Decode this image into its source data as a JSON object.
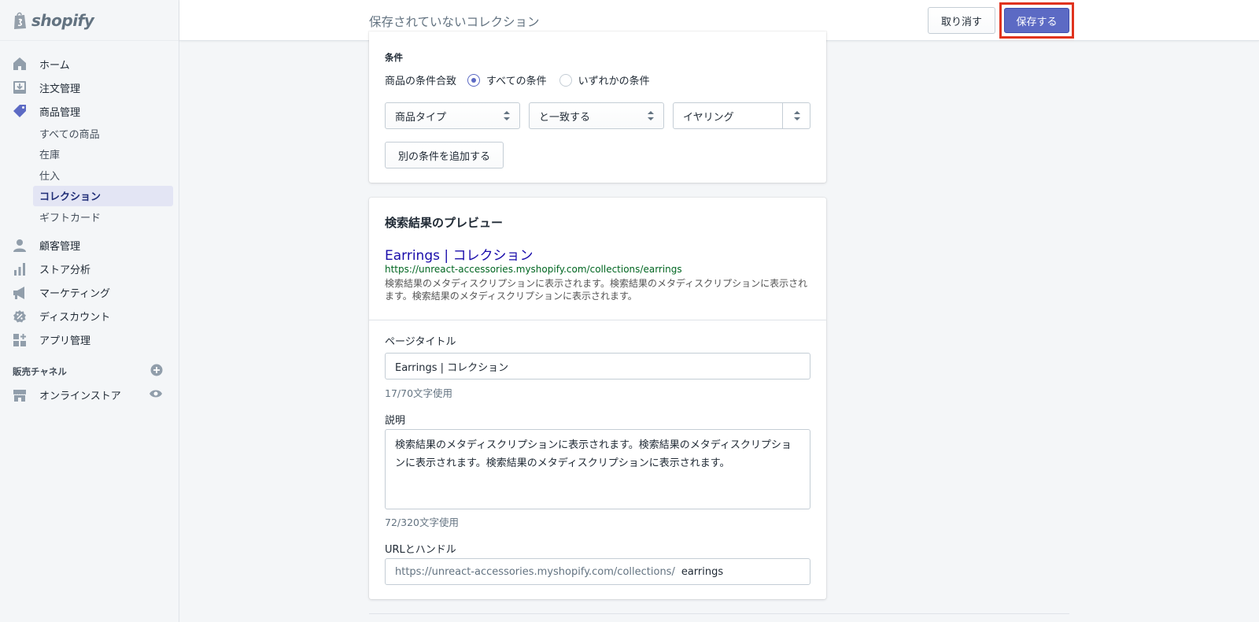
{
  "brand": {
    "name": "shopify"
  },
  "sidebar": {
    "items": [
      {
        "label": "ホーム",
        "icon": "home-icon"
      },
      {
        "label": "注文管理",
        "icon": "orders-icon"
      },
      {
        "label": "商品管理",
        "icon": "products-tag-icon"
      }
    ],
    "sub_items": [
      {
        "label": "すべての商品"
      },
      {
        "label": "在庫"
      },
      {
        "label": "仕入"
      },
      {
        "label": "コレクション",
        "active": true
      },
      {
        "label": "ギフトカード"
      }
    ],
    "items2": [
      {
        "label": "顧客管理",
        "icon": "customers-icon"
      },
      {
        "label": "ストア分析",
        "icon": "analytics-icon"
      },
      {
        "label": "マーケティング",
        "icon": "marketing-icon"
      },
      {
        "label": "ディスカウント",
        "icon": "discount-icon"
      },
      {
        "label": "アプリ管理",
        "icon": "apps-icon"
      }
    ],
    "channels_label": "販売チャネル",
    "channel": {
      "label": "オンラインストア",
      "icon": "online-store-icon"
    }
  },
  "topbar": {
    "title": "保存されていないコレクション",
    "discard_label": "取り消す",
    "save_label": "保存する"
  },
  "conditions": {
    "heading": "条件",
    "match_label": "商品の条件合致",
    "option_all": "すべての条件",
    "option_any": "いずれかの条件",
    "selected": "all",
    "field": "商品タイプ",
    "relation": "と一致する",
    "value": "イヤリング",
    "add_label": "別の条件を追加する"
  },
  "seo": {
    "heading": "検索結果のプレビュー",
    "preview_title": "Earrings | コレクション",
    "preview_url": "https://unreact-accessories.myshopify.com/collections/earrings",
    "preview_desc": "検索結果のメタディスクリプションに表示されます。検索結果のメタディスクリプションに表示されます。検索結果のメタディスクリプションに表示されます。",
    "page_title_label": "ページタイトル",
    "page_title_value": "Earrings | コレクション",
    "page_title_help": "17/70文字使用",
    "description_label": "説明",
    "description_value": "検索結果のメタディスクリプションに表示されます。検索結果のメタディスクリプションに表示されます。検索結果のメタディスクリプションに表示されます。",
    "description_help": "72/320文字使用",
    "url_label": "URLとハンドル",
    "url_prefix": "https://unreact-accessories.myshopify.com/collections/",
    "url_handle": "earrings"
  },
  "colors": {
    "accent": "#5c6ac4",
    "highlight": "#e0331e",
    "link": "#1a0dab",
    "url_green": "#006621",
    "sidebar_icon": "#919eab"
  }
}
